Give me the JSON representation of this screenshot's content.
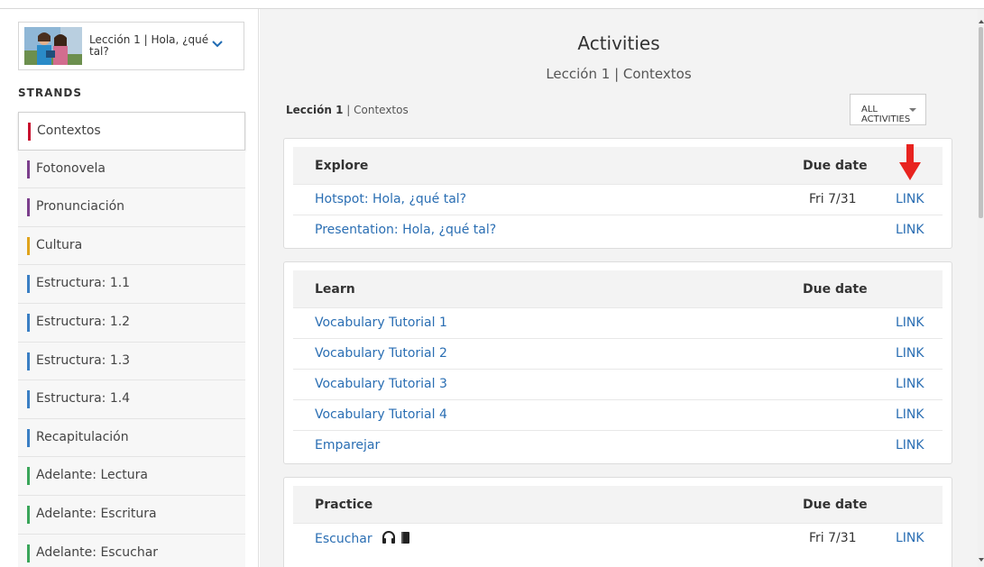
{
  "sidebar": {
    "lesson_selector": "Lección 1 | Hola, ¿qué tal?",
    "strands_title": "STRANDS",
    "strands": [
      {
        "label": "Contextos",
        "color": "#c8102e",
        "active": true
      },
      {
        "label": "Fotonovela",
        "color": "#7b3f8c"
      },
      {
        "label": "Pronunciación",
        "color": "#7b3f8c"
      },
      {
        "label": "Cultura",
        "color": "#e0a31c"
      },
      {
        "label": "Estructura: 1.1",
        "color": "#3a7fc4"
      },
      {
        "label": "Estructura: 1.2",
        "color": "#3a7fc4"
      },
      {
        "label": "Estructura: 1.3",
        "color": "#3a7fc4"
      },
      {
        "label": "Estructura: 1.4",
        "color": "#3a7fc4"
      },
      {
        "label": "Recapitulación",
        "color": "#3a7fc4"
      },
      {
        "label": "Adelante: Lectura",
        "color": "#3aa55a"
      },
      {
        "label": "Adelante: Escritura",
        "color": "#3aa55a"
      },
      {
        "label": "Adelante: Escuchar",
        "color": "#3aa55a"
      }
    ]
  },
  "main": {
    "title": "Activities",
    "subtitle": "Lección 1 | Contextos",
    "breadcrumb_bold": "Lección 1",
    "breadcrumb_rest": " | Contextos",
    "filter_label": "ALL ACTIVITIES",
    "sections": [
      {
        "heading": "Explore",
        "due_header": "Due date",
        "rows": [
          {
            "title": "Hotspot: Hola, ¿qué tal?",
            "due": "Fri 7/31",
            "link": "LINK"
          },
          {
            "title": "Presentation: Hola, ¿qué tal?",
            "due": "",
            "link": "LINK"
          }
        ]
      },
      {
        "heading": "Learn",
        "due_header": "Due date",
        "rows": [
          {
            "title": "Vocabulary Tutorial 1",
            "due": "",
            "link": "LINK"
          },
          {
            "title": "Vocabulary Tutorial 2",
            "due": "",
            "link": "LINK"
          },
          {
            "title": "Vocabulary Tutorial 3",
            "due": "",
            "link": "LINK"
          },
          {
            "title": "Vocabulary Tutorial 4",
            "due": "",
            "link": "LINK"
          },
          {
            "title": "Emparejar",
            "due": "",
            "link": "LINK"
          }
        ]
      },
      {
        "heading": "Practice",
        "due_header": "Due date",
        "rows": [
          {
            "title": "Escuchar",
            "due": "Fri 7/31",
            "link": "LINK",
            "icons": [
              "headphones-icon",
              "book-icon"
            ]
          }
        ]
      }
    ]
  },
  "annotation_color": "#e8231f"
}
